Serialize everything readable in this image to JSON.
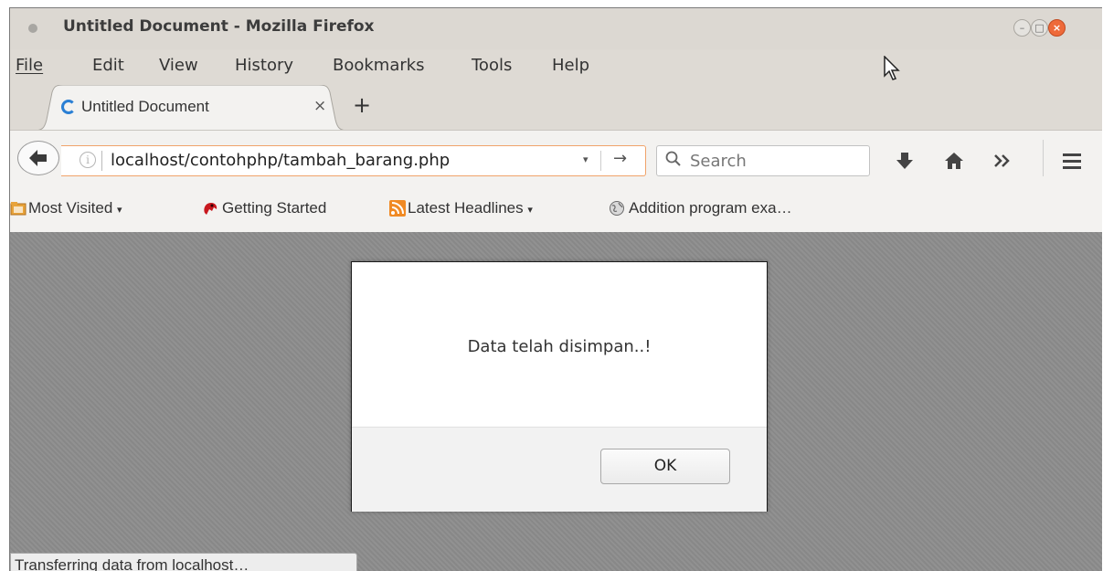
{
  "window": {
    "title": "Untitled Document - Mozilla Firefox"
  },
  "menu": {
    "items": [
      "File",
      "Edit",
      "View",
      "History",
      "Bookmarks",
      "Tools",
      "Help"
    ]
  },
  "tabs": [
    {
      "label": "Untitled Document",
      "close": "×",
      "loading": true
    }
  ],
  "new_tab_label": "+",
  "navbar": {
    "url": "localhost/contohphp/tambah_barang.php",
    "info_glyph": "i",
    "dropdown_glyph": "▾",
    "go_glyph": "→",
    "search_placeholder": "Search"
  },
  "bookmarks": {
    "items": [
      {
        "label": "Most Visited",
        "dropdown": "▾",
        "icon": "folder-icon"
      },
      {
        "label": "Getting Started",
        "icon": "firefox-icon"
      },
      {
        "label": "Latest Headlines",
        "dropdown": "▾",
        "icon": "rss-icon"
      },
      {
        "label": "Addition program exa…",
        "icon": "globe-icon"
      }
    ]
  },
  "dialog": {
    "message": "Data telah disimpan..!",
    "ok_label": "OK"
  },
  "status": {
    "text": "Transferring data from localhost…"
  },
  "colors": {
    "accent": "#f0a36a",
    "close_button": "#ee6a3a",
    "content_background": "#8d8d8d"
  }
}
